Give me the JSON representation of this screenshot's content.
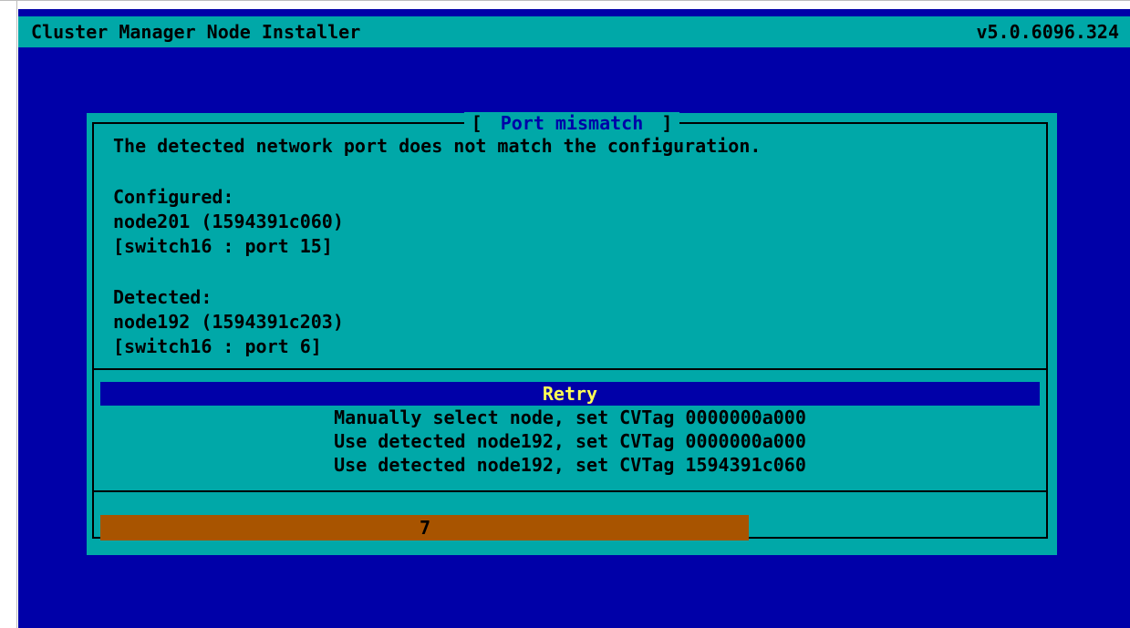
{
  "window": {
    "title": "Cluster Manager Node Installer",
    "version": "v5.0.6096.324"
  },
  "dialog": {
    "title": "Port mismatch",
    "title_open": "[",
    "title_close": "]",
    "message": "The detected network port does not match the configuration.",
    "configured": {
      "label": "Configured:",
      "node": "node201 (1594391c060)",
      "port": "[switch16 : port 15]"
    },
    "detected": {
      "label": "Detected:",
      "node": "node192 (1594391c203)",
      "port": "[switch16 : port 6]"
    }
  },
  "menu": {
    "items": [
      {
        "label": "Retry",
        "selected": true
      },
      {
        "label": "Manually select node, set CVTag 0000000a000",
        "selected": false
      },
      {
        "label": "Use detected node192, set CVTag 0000000a000",
        "selected": false
      },
      {
        "label": "Use detected node192, set CVTag 1594391c060",
        "selected": false
      }
    ]
  },
  "countdown": {
    "value": "7",
    "progress_fraction": 0.69
  },
  "colors": {
    "screen_bg": "#0000a8",
    "dialog_bg": "#00a8a8",
    "selected_fg": "#ffff55",
    "progress": "#a85400"
  }
}
